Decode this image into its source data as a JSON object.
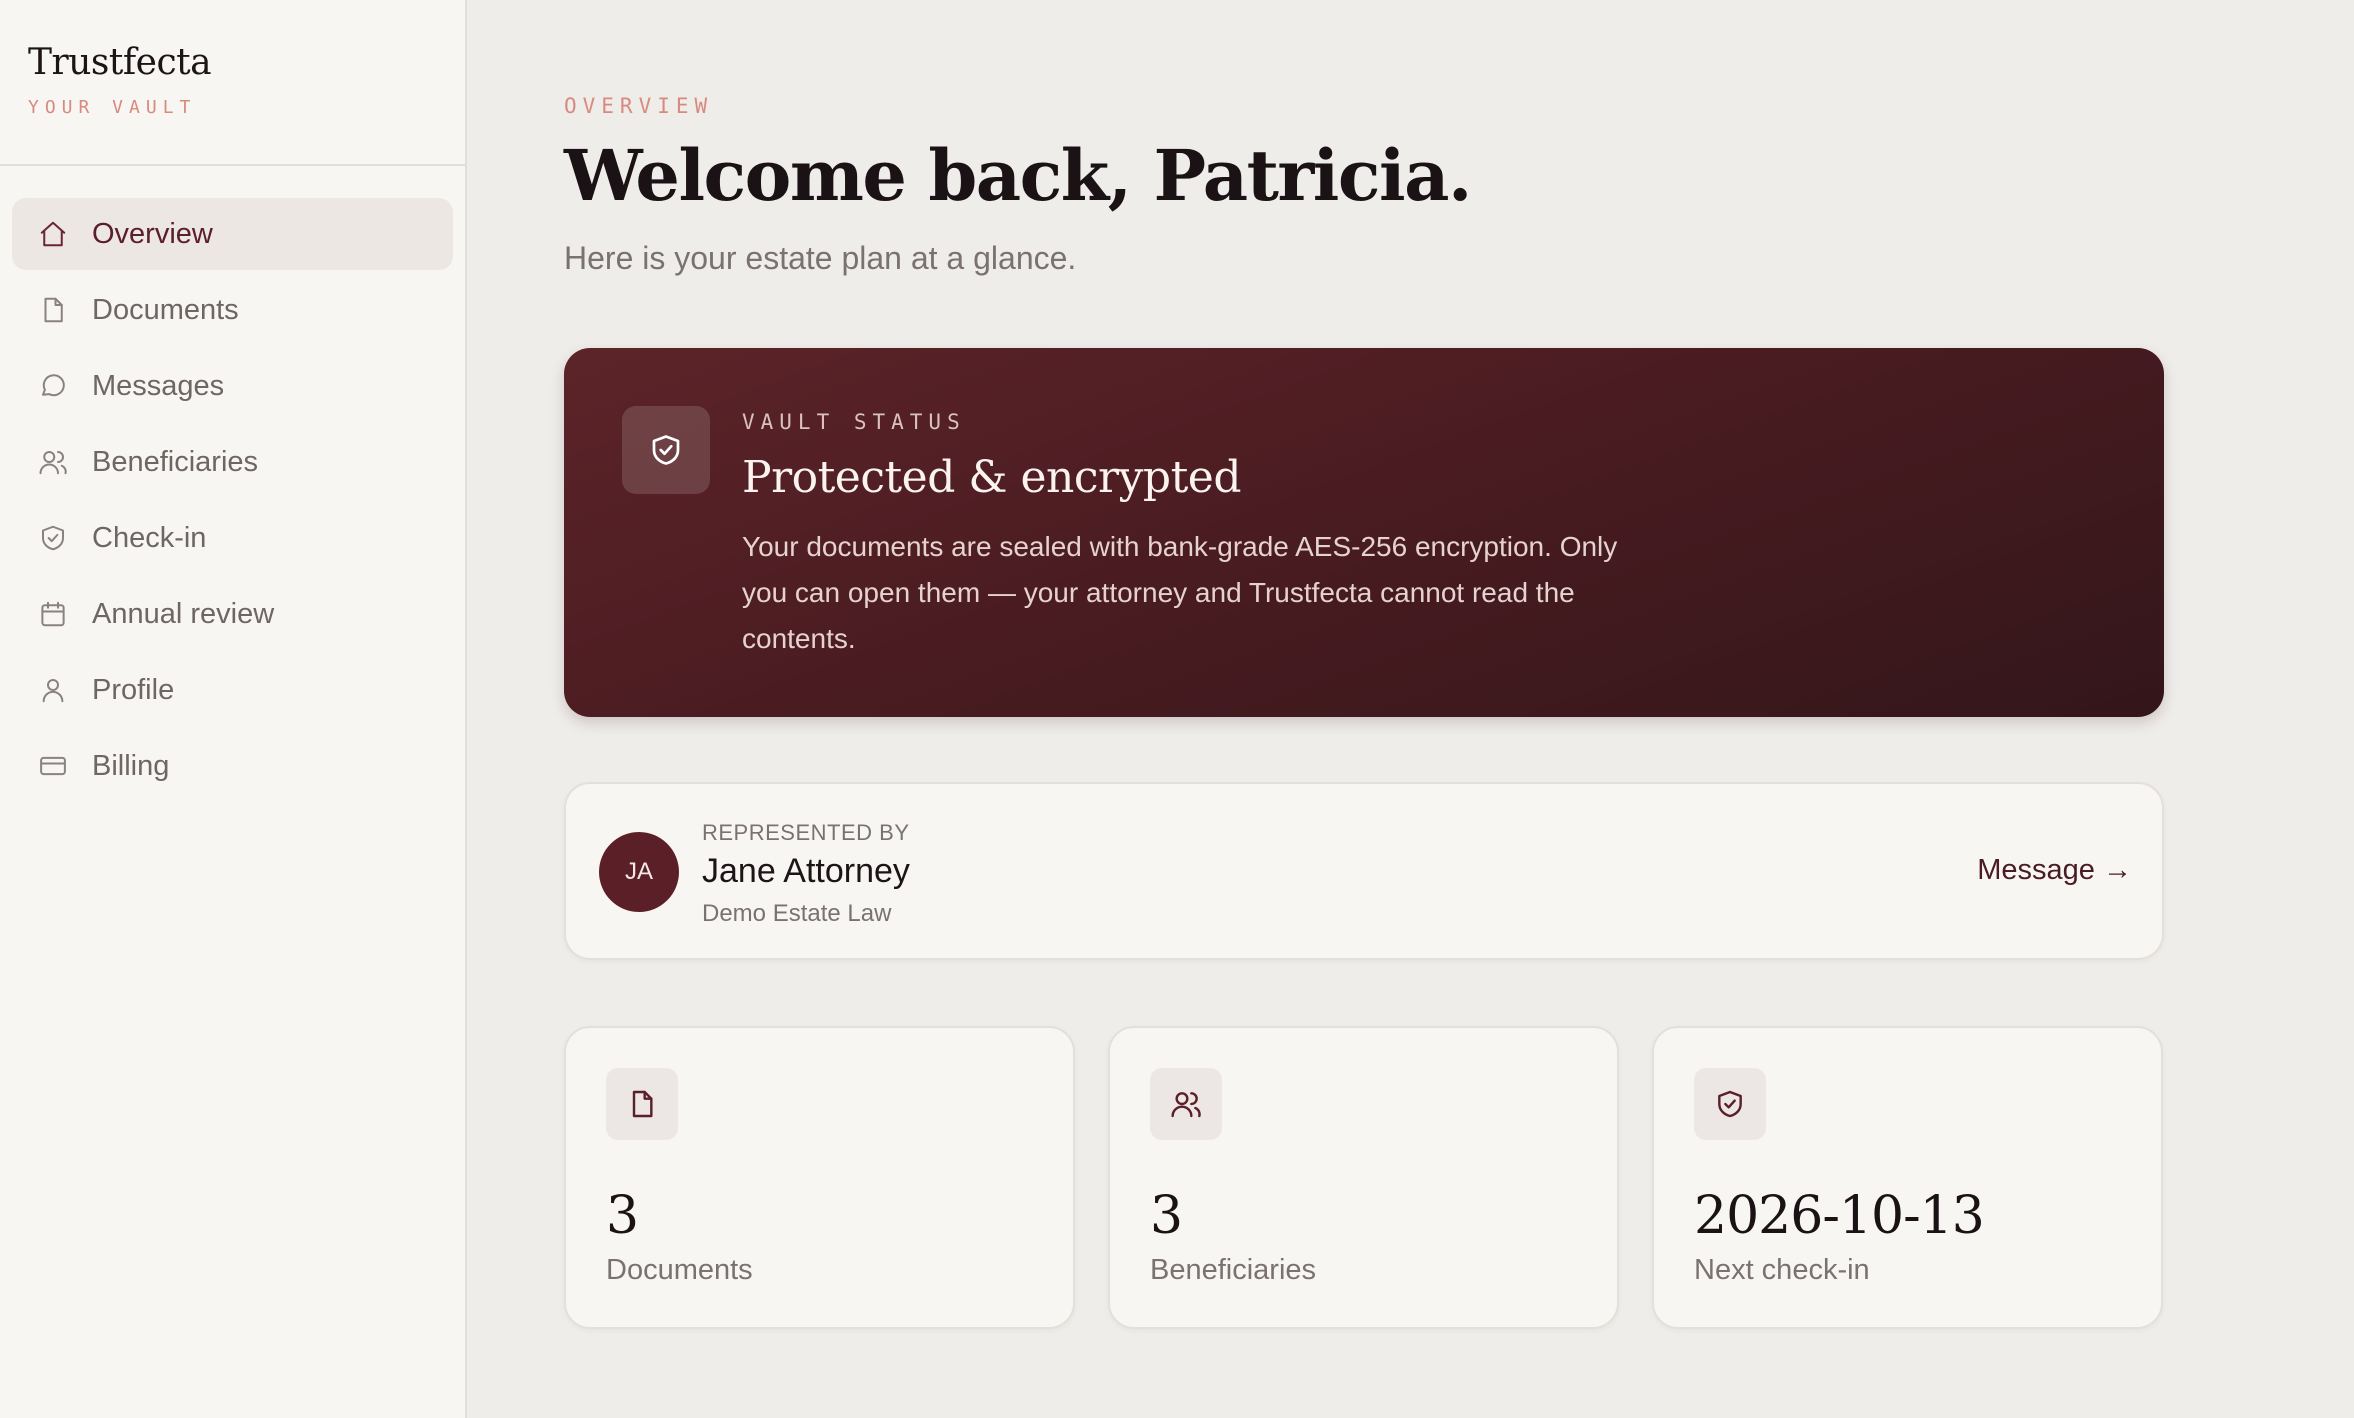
{
  "sidebar": {
    "brand_name": "Trustfecta",
    "brand_sub": "YOUR VAULT",
    "items": [
      {
        "label": "Overview",
        "icon": "home-icon",
        "active": true
      },
      {
        "label": "Documents",
        "icon": "document-icon"
      },
      {
        "label": "Messages",
        "icon": "chat-icon"
      },
      {
        "label": "Beneficiaries",
        "icon": "users-icon"
      },
      {
        "label": "Check-in",
        "icon": "shield-check-icon"
      },
      {
        "label": "Annual review",
        "icon": "calendar-icon"
      },
      {
        "label": "Profile",
        "icon": "user-icon"
      },
      {
        "label": "Billing",
        "icon": "credit-card-icon"
      }
    ]
  },
  "header": {
    "eyebrow": "OVERVIEW",
    "title": "Welcome back, Patricia.",
    "subtitle": "Here is your estate plan at a glance."
  },
  "vault": {
    "eyebrow": "VAULT STATUS",
    "title": "Protected & encrypted",
    "body": "Your documents are sealed with bank-grade AES-256 encryption. Only you can open them — your attorney and Trustfecta cannot read the contents.",
    "icon": "shield-check-icon"
  },
  "attorney": {
    "initials": "JA",
    "label": "REPRESENTED BY",
    "name": "Jane Attorney",
    "firm": "Demo Estate Law",
    "message_label": "Message →"
  },
  "stats": [
    {
      "value": "3",
      "label": "Documents",
      "icon": "document-icon"
    },
    {
      "value": "3",
      "label": "Beneficiaries",
      "icon": "users-icon"
    },
    {
      "value": "2026-10-13",
      "label": "Next check-in",
      "icon": "shield-check-icon"
    }
  ],
  "colors": {
    "accent": "#5a1f27",
    "eyebrow": "#d98a7e",
    "background": "#efedea",
    "sidebar": "#f8f6f3"
  }
}
